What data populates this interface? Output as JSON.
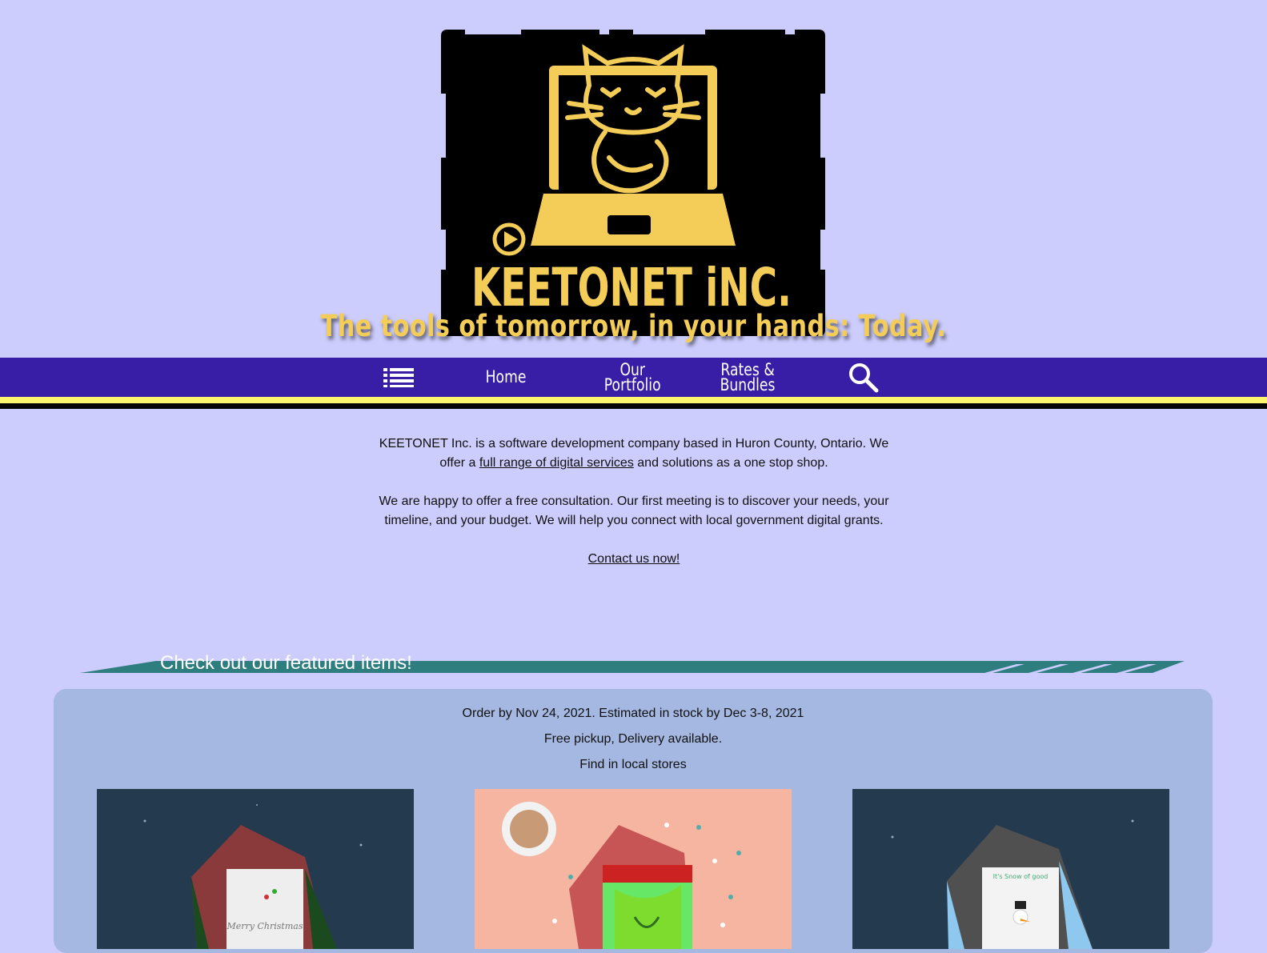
{
  "brand": {
    "logo_text": "KEETONET iNC.",
    "tagline": "The tools of tomorrow, in your hands: Today.",
    "colors": {
      "gold": "#f4cd59",
      "logo_bg": "#000000",
      "nav_bg": "#381ea6",
      "page_bg": "#ccccfd"
    }
  },
  "nav": {
    "menu_icon": "hamburger-list-icon",
    "items": [
      {
        "line1": "Home",
        "line2": ""
      },
      {
        "line1": "Our",
        "line2": "Portfolio"
      },
      {
        "line1": "Rates &",
        "line2": "Bundles"
      }
    ],
    "search_icon": "magnifier-icon"
  },
  "intro": {
    "p1_before": "KEETONET Inc. is a software development company based in Huron County, Ontario. We offer a ",
    "p1_link": "full range of digital services",
    "p1_after": " and solutions as a one stop shop.",
    "p2": "We are happy to offer a free consultation. Our first meeting is to discover your needs, your timeline, and your budget. We will help you connect with local government digital grants.",
    "contact_link": "Contact us now!"
  },
  "featured": {
    "title": "Check out our featured items!",
    "order_line": "Order by Nov 24, 2021. Estimated in stock by Dec 3-8, 2021",
    "pickup_line": "Free pickup, Delivery available.",
    "stores_line": "Find in local stores",
    "cards": [
      {
        "card_text": "Merry Christmas"
      },
      {
        "card_text": ""
      },
      {
        "card_text": "It's Snow of good"
      }
    ]
  }
}
